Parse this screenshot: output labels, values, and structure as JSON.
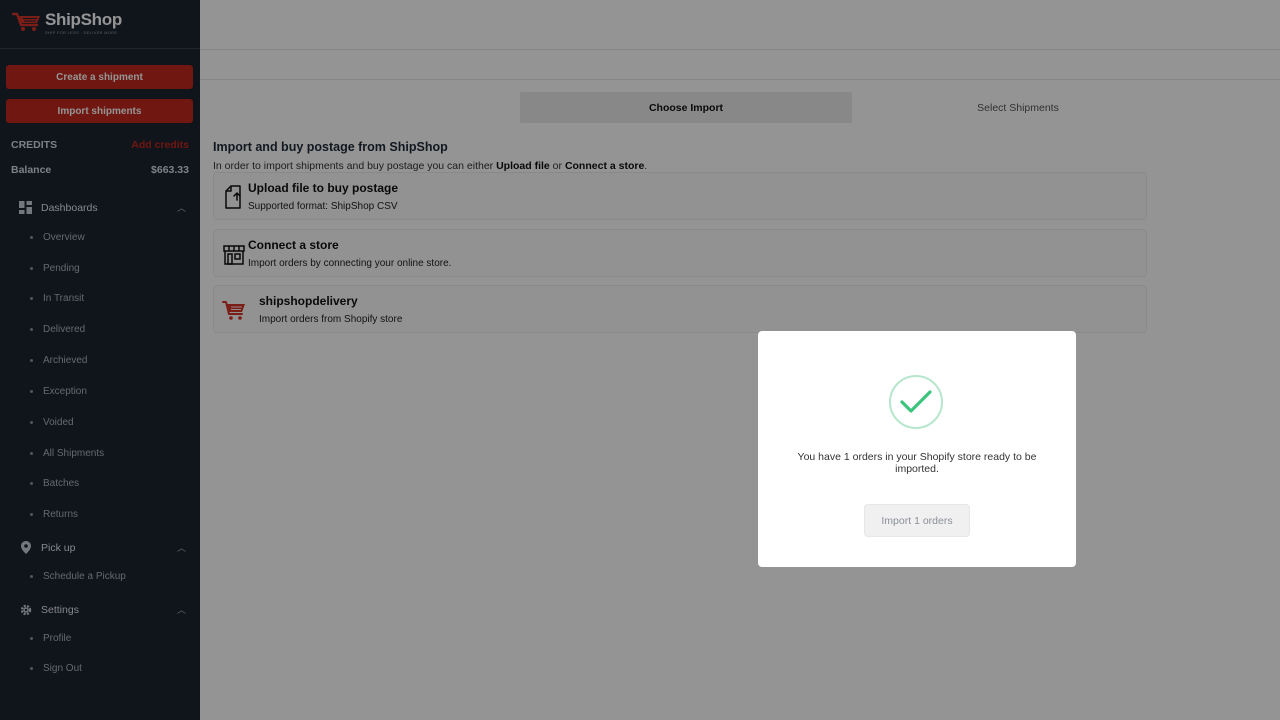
{
  "brand": {
    "name": "ShipShop",
    "tagline": "SHIP FOR LESS · DELIVER MORE"
  },
  "sidebar": {
    "create_button": "Create a shipment",
    "import_button": "Import shipments",
    "credits_label": "CREDITS",
    "add_credits": "Add credits",
    "balance_label": "Balance",
    "balance_value": "$663.33",
    "groups": [
      {
        "label": "Dashboards",
        "icon": "dashboard-icon",
        "items": [
          "Overview",
          "Pending",
          "In Transit",
          "Delivered",
          "Archieved",
          "Exception",
          "Voided",
          "All Shipments",
          "Batches",
          "Returns"
        ]
      },
      {
        "label": "Pick up",
        "icon": "map-pin-icon",
        "items": [
          "Schedule a Pickup"
        ]
      },
      {
        "label": "Settings",
        "icon": "gear-icon",
        "items": [
          "Profile",
          "Sign Out"
        ]
      }
    ]
  },
  "steps": {
    "active": "Choose Import",
    "inactive": "Select Shipments"
  },
  "import": {
    "title": "Import and buy postage from ShipShop",
    "desc_prefix": "In order to import shipments and buy postage you can either ",
    "desc_link1": "Upload file",
    "desc_middle": " or ",
    "desc_link2": "Connect a store",
    "desc_suffix": ".",
    "cards": [
      {
        "title": "Upload file to buy postage",
        "subtitle": "Supported format: ShipShop CSV",
        "icon": "file-upload-icon"
      },
      {
        "title": "Connect a store",
        "subtitle": "Import orders by connecting your online store.",
        "icon": "storefront-icon"
      },
      {
        "title": "shipshopdelivery",
        "subtitle": "Import orders from Shopify store",
        "icon": "shipshop-cart-icon"
      }
    ]
  },
  "modal": {
    "message": "You have 1 orders in your Shopify store ready to be imported.",
    "button": "Import 1 orders",
    "icon": "check-icon"
  },
  "colors": {
    "accent": "#c0281d",
    "sidebar_bg": "#1d2330",
    "success": "#3cc47c"
  }
}
